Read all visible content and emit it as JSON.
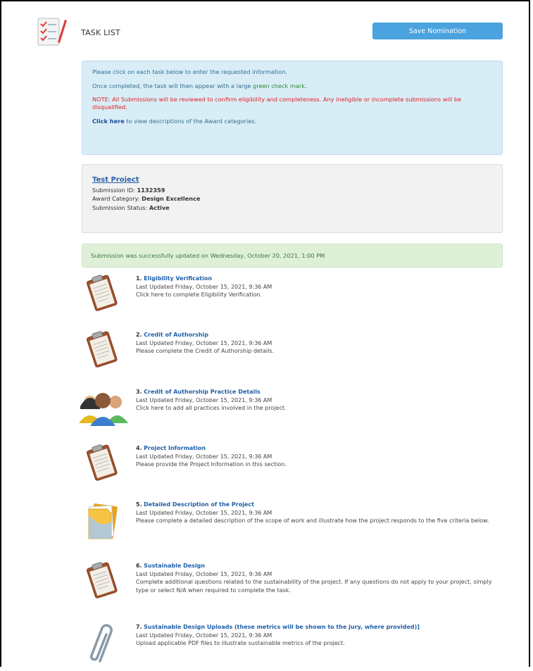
{
  "header": {
    "title": "TASK LIST",
    "save_label": "Save Nomination"
  },
  "info": {
    "line1": "Please click on each task below to enter the requested information.",
    "line2_before": "Once completed, the task will then appear with a large ",
    "line2_green": "green check mark",
    "line2_after": ".",
    "note": "NOTE: All Submissions will be reviewed to confirm eligibility and completeness. Any ineligible or incomplete submissions will be disqualified.",
    "click_here": "Click here",
    "click_rest": " to view descriptions of the Award categories."
  },
  "project": {
    "name": "Test Project",
    "id_label": "Submission ID: ",
    "id_value": "1132359",
    "category_label": "Award Category: ",
    "category_value": "Design Excellence",
    "status_label": "Submission Status: ",
    "status_value": "Active"
  },
  "success": {
    "text": "Submission was successfully updated on Wednesday, October 20, 2021, 1:00 PM"
  },
  "tasks": [
    {
      "num": "1.",
      "title": "Eligibility Verification",
      "updated": "Last Updated Friday, October 15, 2021, 9:36 AM",
      "desc": "Click here to complete Eligibility Verification.",
      "icon": "clipboard-icon"
    },
    {
      "num": "2.",
      "title": "Credit of Authorship",
      "updated": "Last Updated Friday, October 15, 2021, 9:36 AM",
      "desc": "Please complete the Credit of Authorship details.",
      "icon": "clipboard-icon"
    },
    {
      "num": "3.",
      "title": "Credit of Authorship Practice Details",
      "updated": "Last Updated Friday, October 15, 2021, 9:36 AM",
      "desc": "Click here to add all practices involved in the project.",
      "icon": "people-icon"
    },
    {
      "num": "4.",
      "title": "Project Information",
      "updated": "Last Updated Friday, October 15, 2021, 9:36 AM",
      "desc": "Please provide the Project Information in this section.",
      "icon": "clipboard-icon"
    },
    {
      "num": "5.",
      "title": "Detailed Description of the Project",
      "updated": "Last Updated Friday, October 15, 2021, 9:36 AM",
      "desc": "Please complete a detailed description of the scope of work and illustrate how the project responds to the five criteria below.",
      "icon": "folder-icon"
    },
    {
      "num": "6.",
      "title": "Sustainable Design",
      "updated": "Last Updated Friday, October 15, 2021, 9:36 AM",
      "desc": "Complete additional questions related to the sustainability of the project. If any questions do not apply to your project, simply type or select N/A when required to complete the task.",
      "icon": "clipboard-icon"
    },
    {
      "num": "7.",
      "title": "Sustainable Design Uploads (these metrics will be shown to the jury, where provided)]",
      "updated": "Last Updated Friday, October 15, 2021, 9:36 AM",
      "desc": "Upload applicable PDF files to illustrate sustainable metrics of the project.",
      "icon": "paperclip-icon"
    }
  ]
}
